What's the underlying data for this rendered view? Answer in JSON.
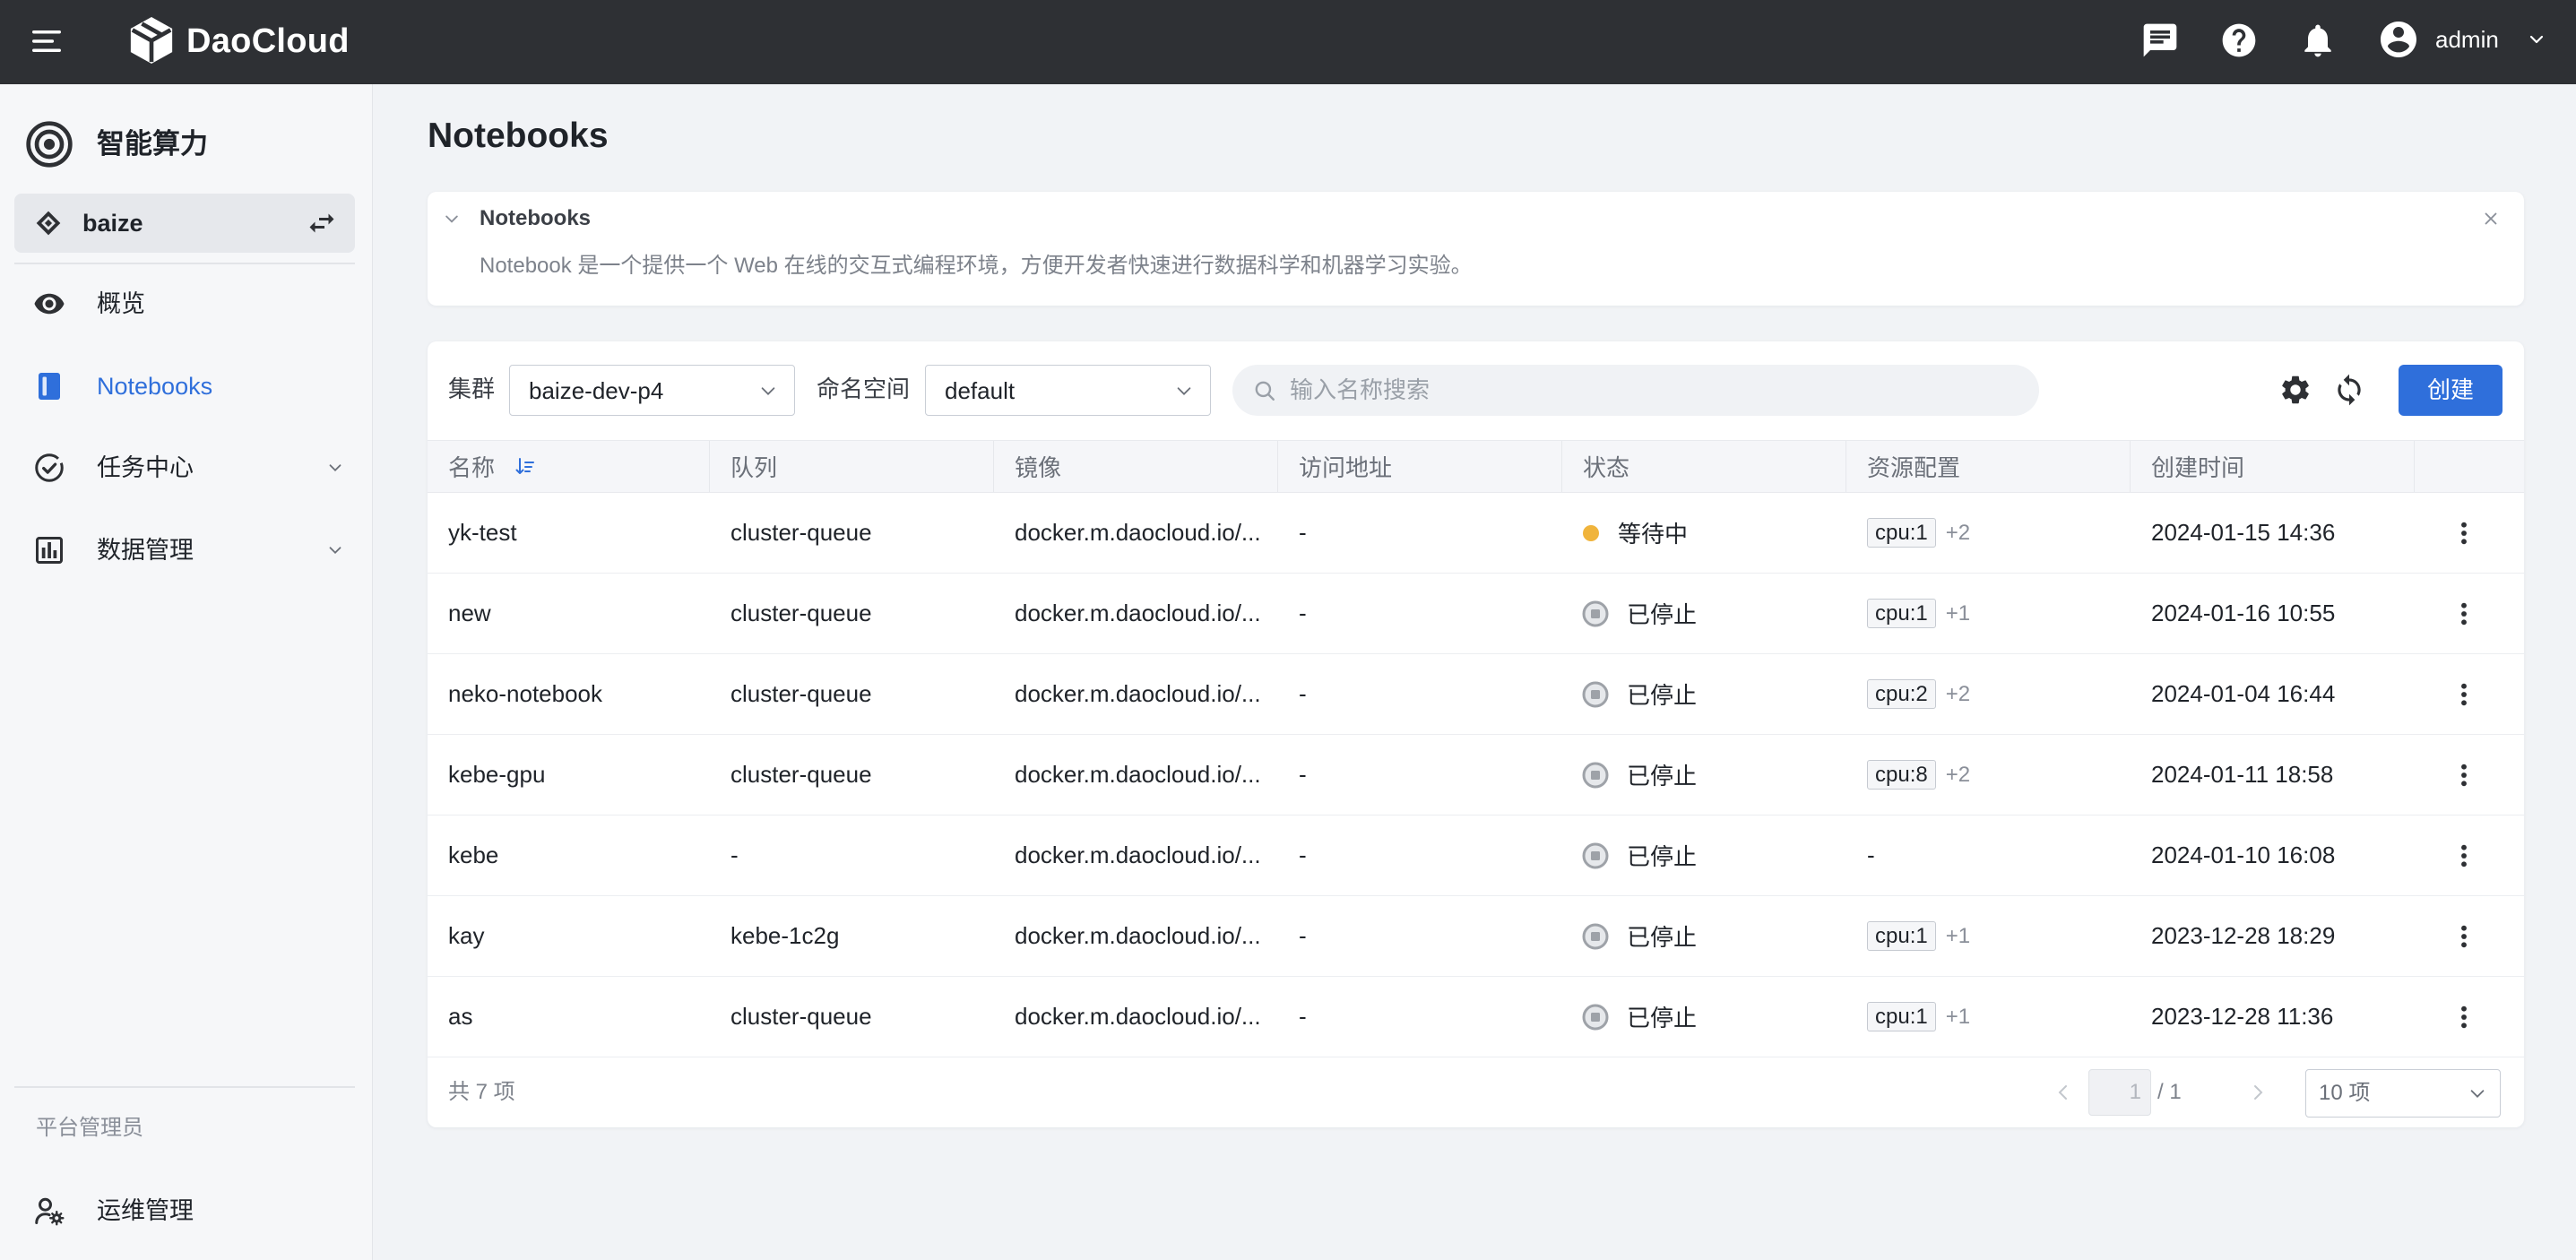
{
  "colors": {
    "topbar": "#2e3034",
    "accent": "#2f6fdb",
    "pending": "#f0b43c",
    "stopped": "#9ea2a8"
  },
  "topbar": {
    "brand": "DaoCloud",
    "user": "admin",
    "icons": [
      "menu-icon",
      "daocloud-logo-icon",
      "chat-icon",
      "help-icon",
      "bell-icon",
      "avatar-icon",
      "chevron-down-icon"
    ]
  },
  "sidebar": {
    "module_title": "智能算力",
    "workspace": "baize",
    "items": [
      {
        "label": "概览",
        "icon": "eye-icon"
      },
      {
        "label": "Notebooks",
        "icon": "notebook-icon",
        "active": true
      },
      {
        "label": "任务中心",
        "icon": "task-center-icon",
        "expandable": true
      },
      {
        "label": "数据管理",
        "icon": "data-management-icon",
        "expandable": true
      }
    ],
    "section_label": "平台管理员",
    "admin_items": [
      {
        "label": "运维管理",
        "icon": "ops-admin-icon"
      }
    ]
  },
  "page": {
    "title": "Notebooks"
  },
  "banner": {
    "title": "Notebooks",
    "description": "Notebook 是一个提供一个 Web 在线的交互式编程环境，方便开发者快速进行数据科学和机器学习实验。"
  },
  "toolbar": {
    "cluster_label": "集群",
    "cluster_value": "baize-dev-p4",
    "namespace_label": "命名空间",
    "namespace_value": "default",
    "search_placeholder": "输入名称搜索",
    "create_label": "创建"
  },
  "table": {
    "columns": [
      "名称",
      "队列",
      "镜像",
      "访问地址",
      "状态",
      "资源配置",
      "创建时间"
    ],
    "sorted_column": "名称",
    "rows": [
      {
        "name": "yk-test",
        "queue": "cluster-queue",
        "image": "docker.m.daocloud.io/...",
        "url": "-",
        "status": "等待中",
        "status_icon": "pending-dot-icon",
        "resource_tag": "cpu:1",
        "resource_more": "+2",
        "created": "2024-01-15 14:36"
      },
      {
        "name": "new",
        "queue": "cluster-queue",
        "image": "docker.m.daocloud.io/...",
        "url": "-",
        "status": "已停止",
        "status_icon": "stopped-icon",
        "resource_tag": "cpu:1",
        "resource_more": "+1",
        "created": "2024-01-16 10:55"
      },
      {
        "name": "neko-notebook",
        "queue": "cluster-queue",
        "image": "docker.m.daocloud.io/...",
        "url": "-",
        "status": "已停止",
        "status_icon": "stopped-icon",
        "resource_tag": "cpu:2",
        "resource_more": "+2",
        "created": "2024-01-04 16:44"
      },
      {
        "name": "kebe-gpu",
        "queue": "cluster-queue",
        "image": "docker.m.daocloud.io/...",
        "url": "-",
        "status": "已停止",
        "status_icon": "stopped-icon",
        "resource_tag": "cpu:8",
        "resource_more": "+2",
        "created": "2024-01-11 18:58"
      },
      {
        "name": "kebe",
        "queue": "-",
        "image": "docker.m.daocloud.io/...",
        "url": "-",
        "status": "已停止",
        "status_icon": "stopped-icon",
        "resource_text": "-",
        "created": "2024-01-10 16:08"
      },
      {
        "name": "kay",
        "queue": "kebe-1c2g",
        "image": "docker.m.daocloud.io/...",
        "url": "-",
        "status": "已停止",
        "status_icon": "stopped-icon",
        "resource_tag": "cpu:1",
        "resource_more": "+1",
        "created": "2023-12-28 18:29"
      },
      {
        "name": "as",
        "queue": "cluster-queue",
        "image": "docker.m.daocloud.io/...",
        "url": "-",
        "status": "已停止",
        "status_icon": "stopped-icon",
        "resource_tag": "cpu:1",
        "resource_more": "+1",
        "created": "2023-12-28 11:36"
      }
    ]
  },
  "pagination": {
    "total": "共 7 项",
    "current": "1",
    "pages": "/ 1",
    "page_size": "10 项"
  }
}
